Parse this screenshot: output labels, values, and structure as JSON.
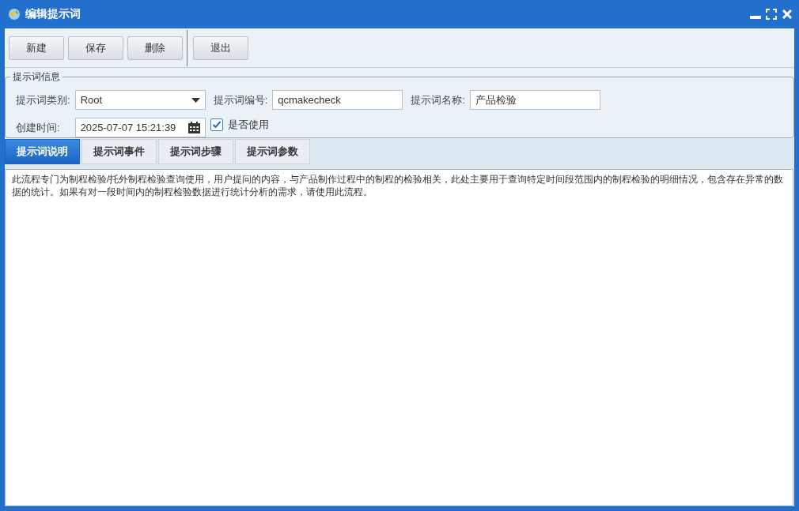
{
  "window": {
    "title": "编辑提示词"
  },
  "toolbar": [
    {
      "label": "新建"
    },
    {
      "label": "保存"
    },
    {
      "label": "删除"
    },
    {
      "label": "退出",
      "separated": true
    }
  ],
  "info": {
    "legend": "提示词信息",
    "category": {
      "label": "提示词类别:",
      "value": "Root"
    },
    "code": {
      "label": "提示词编号:",
      "value": "qcmakecheck"
    },
    "name": {
      "label": "提示词名称:",
      "value": "产品检验"
    },
    "created": {
      "label": "创建时间:",
      "value": "2025-07-07 15:21:39"
    },
    "in_use": {
      "label": "是否使用",
      "checked": true
    }
  },
  "tabs": [
    {
      "label": "提示词说明",
      "selected": true
    },
    {
      "label": "提示词事件",
      "selected": false
    },
    {
      "label": "提示词步骤",
      "selected": false
    },
    {
      "label": "提示词参数",
      "selected": false
    }
  ],
  "description": "此流程专门为制程检验/托外制程检验查询使用，用户提问的内容，与产品制作过程中的制程的检验相关，此处主要用于查询特定时间段范围内的制程检验的明细情况，包含存在异常的数据的统计。如果有对一段时间内的制程检验数据进行统计分析的需求，请使用此流程。"
}
